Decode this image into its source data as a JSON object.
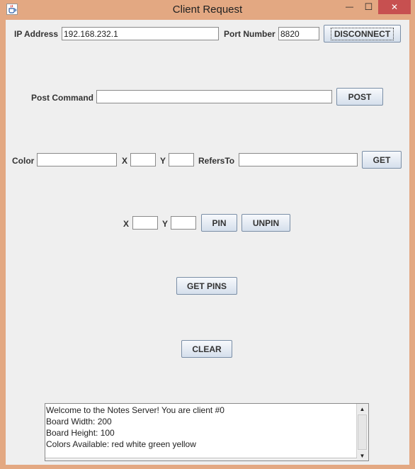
{
  "window": {
    "title": "Client Request",
    "minimize_glyph": "—",
    "maximize_glyph": "☐",
    "close_glyph": "✕",
    "close_color": "#c75050"
  },
  "connection": {
    "ip_label": "IP Address",
    "ip_value": "192.168.232.1",
    "port_label": "Port Number",
    "port_value": "8820",
    "disconnect_label": "DISCONNECT"
  },
  "post": {
    "label": "Post Command",
    "value": "",
    "button_label": "POST"
  },
  "get": {
    "color_label": "Color",
    "color_value": "",
    "x_label": "X",
    "x_value": "",
    "y_label": "Y",
    "y_value": "",
    "refers_label": "RefersTo",
    "refers_value": "",
    "button_label": "GET"
  },
  "pin": {
    "x_label": "X",
    "x_value": "",
    "y_label": "Y",
    "y_value": "",
    "pin_label": "PIN",
    "unpin_label": "UNPIN"
  },
  "get_pins": {
    "label": "GET PINS"
  },
  "clear": {
    "label": "CLEAR"
  },
  "output": {
    "lines": [
      "Welcome to the Notes Server! You are client #0",
      "Board Width: 200",
      "Board Height: 100",
      "Colors Available: red white green yellow"
    ],
    "scroll_up_glyph": "▲",
    "scroll_down_glyph": "▼"
  },
  "icons": {
    "app": "java-cup-icon"
  }
}
